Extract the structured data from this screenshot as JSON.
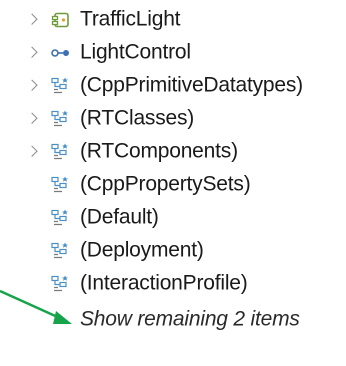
{
  "tree": {
    "items": [
      {
        "label": "TrafficLight",
        "icon": "component-icon",
        "expandable": true
      },
      {
        "label": "LightControl",
        "icon": "interface-icon",
        "expandable": true
      },
      {
        "label": "(CppPrimitiveDatatypes)",
        "icon": "package-import-icon",
        "expandable": true
      },
      {
        "label": "(RTClasses)",
        "icon": "package-import-icon",
        "expandable": true
      },
      {
        "label": "(RTComponents)",
        "icon": "package-import-icon",
        "expandable": true
      },
      {
        "label": "(CppPropertySets)",
        "icon": "package-import-icon",
        "expandable": false
      },
      {
        "label": "(Default)",
        "icon": "package-import-icon",
        "expandable": false
      },
      {
        "label": "(Deployment)",
        "icon": "package-import-icon",
        "expandable": false
      },
      {
        "label": "(InteractionProfile)",
        "icon": "package-import-icon",
        "expandable": false
      }
    ],
    "show_more_label": "Show remaining 2 items"
  },
  "colors": {
    "annotation_arrow": "#16a34a",
    "chevron": "#8a8a8a",
    "component_icon": "#6f9a3c",
    "interface_icon": "#3d6fb3",
    "package_icon": "#4a8fc7"
  }
}
